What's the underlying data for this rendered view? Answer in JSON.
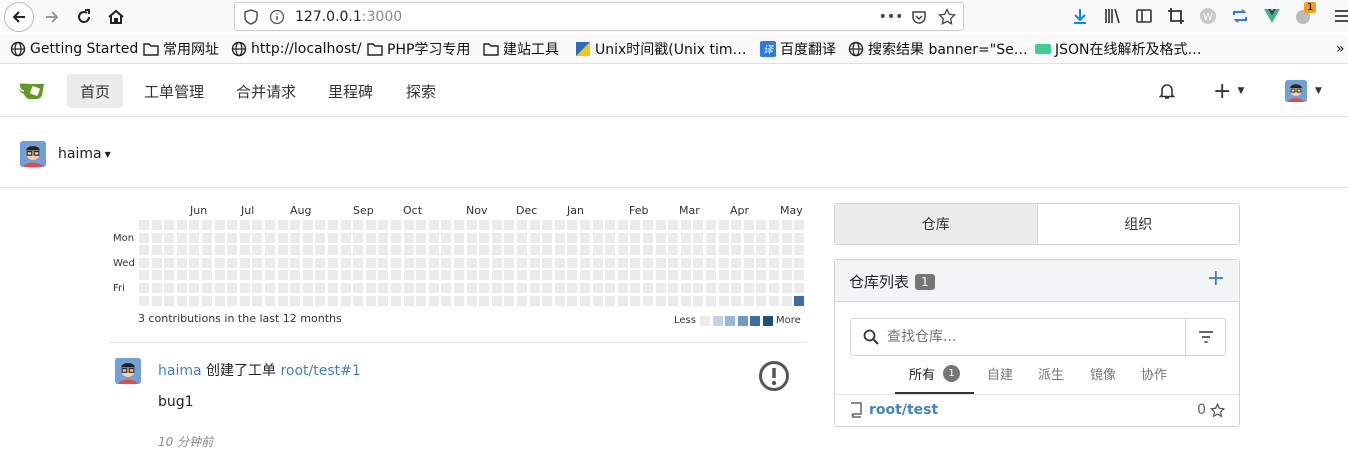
{
  "browser": {
    "url_host": "127.0.0.1",
    "url_port": ":3000",
    "bookmarks": [
      {
        "label": "Getting Started",
        "icon": "globe-icon"
      },
      {
        "label": "常用网址",
        "icon": "folder-icon"
      },
      {
        "label": "http://localhost/",
        "icon": "globe-icon"
      },
      {
        "label": "PHP学习专用",
        "icon": "folder-icon"
      },
      {
        "label": "建站工具",
        "icon": "folder-icon"
      },
      {
        "label": "Unix时间戳(Unix tim…",
        "icon": "unix-icon"
      },
      {
        "label": "百度翻译",
        "icon": "translate-icon"
      },
      {
        "label": "搜索结果 banner=\"Se…",
        "icon": "globe-icon"
      },
      {
        "label": "JSON在线解析及格式…",
        "icon": "json-icon"
      }
    ],
    "download_badge": "1"
  },
  "nav": {
    "items": [
      "首页",
      "工单管理",
      "合并请求",
      "里程碑",
      "探索"
    ],
    "plus": "+"
  },
  "profile": {
    "username": "haima"
  },
  "heatmap": {
    "months": [
      "Jun",
      "Jul",
      "Aug",
      "Sep",
      "Oct",
      "Nov",
      "Dec",
      "Jan",
      "Feb",
      "Mar",
      "Apr",
      "May"
    ],
    "days": [
      "Mon",
      "Wed",
      "Fri"
    ],
    "summary": "3 contributions in the last 12 months",
    "less": "Less",
    "more": "More",
    "colors": [
      "#ebebeb",
      "#c3d4e6",
      "#9ab7d6",
      "#6e9ac4",
      "#3c6fa8",
      "#1f4e80"
    ]
  },
  "feed": {
    "user": "haima",
    "action": "创建了工单",
    "ref": "root/test#1",
    "title": "bug1",
    "time": "10 分钟前"
  },
  "right_tabs": [
    "仓库",
    "组织"
  ],
  "repo_box": {
    "title": "仓库列表",
    "count": "1",
    "add": "+",
    "search_placeholder": "查找仓库...",
    "filters": [
      {
        "label": "所有",
        "badge": "1"
      },
      {
        "label": "自建"
      },
      {
        "label": "派生"
      },
      {
        "label": "镜像"
      },
      {
        "label": "协作"
      }
    ],
    "repos": [
      {
        "name": "root/test",
        "stars": "0"
      }
    ]
  }
}
